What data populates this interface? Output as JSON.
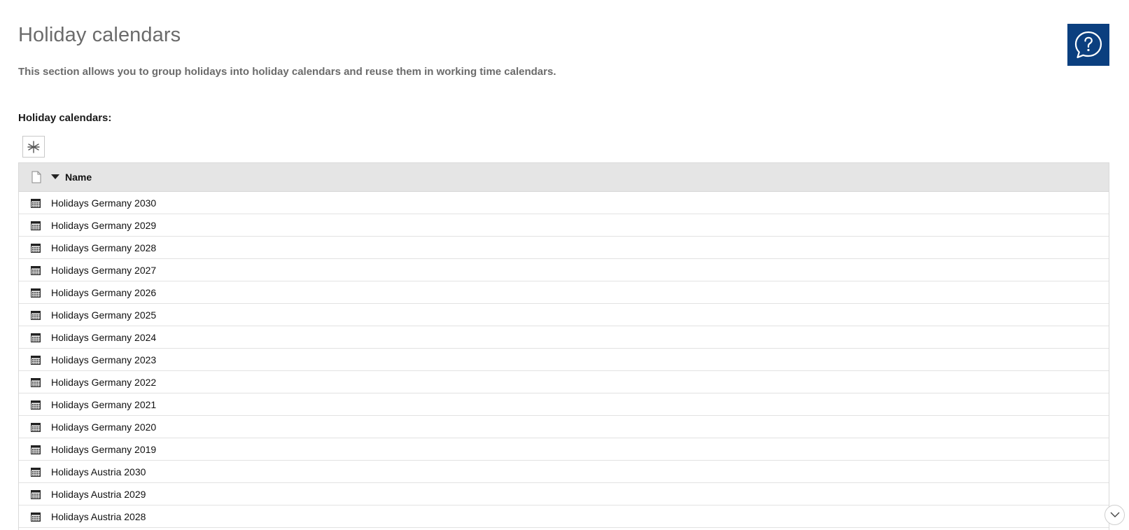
{
  "header": {
    "title": "Holiday calendars",
    "description": "This section allows you to group holidays into holiday calendars and reuse them in working time calendars.",
    "help_icon": "help-bubble-icon"
  },
  "section": {
    "label": "Holiday calendars:",
    "add_icon": "asterisk-add-icon"
  },
  "grid": {
    "columns": [
      {
        "key": "type",
        "label": "",
        "icon": "document-icon"
      },
      {
        "key": "name",
        "label": "Name",
        "sort": "descending"
      }
    ],
    "rows": [
      {
        "icon": "calendar-icon",
        "name": "Holidays Germany 2030"
      },
      {
        "icon": "calendar-icon",
        "name": "Holidays Germany 2029"
      },
      {
        "icon": "calendar-icon",
        "name": "Holidays Germany 2028"
      },
      {
        "icon": "calendar-icon",
        "name": "Holidays Germany 2027"
      },
      {
        "icon": "calendar-icon",
        "name": "Holidays Germany 2026"
      },
      {
        "icon": "calendar-icon",
        "name": "Holidays Germany 2025"
      },
      {
        "icon": "calendar-icon",
        "name": "Holidays Germany 2024"
      },
      {
        "icon": "calendar-icon",
        "name": "Holidays Germany 2023"
      },
      {
        "icon": "calendar-icon",
        "name": "Holidays Germany 2022"
      },
      {
        "icon": "calendar-icon",
        "name": "Holidays Germany 2021"
      },
      {
        "icon": "calendar-icon",
        "name": "Holidays Germany 2020"
      },
      {
        "icon": "calendar-icon",
        "name": "Holidays Germany 2019"
      },
      {
        "icon": "calendar-icon",
        "name": "Holidays Austria 2030"
      },
      {
        "icon": "calendar-icon",
        "name": "Holidays Austria 2029"
      },
      {
        "icon": "calendar-icon",
        "name": "Holidays Austria 2028"
      }
    ]
  },
  "scroll": {
    "icon": "chevron-down-icon"
  },
  "colors": {
    "help_button_bg": "#0b3f7f",
    "title_text": "#6b6b6b",
    "grid_header_bg": "#e5e5e5"
  }
}
